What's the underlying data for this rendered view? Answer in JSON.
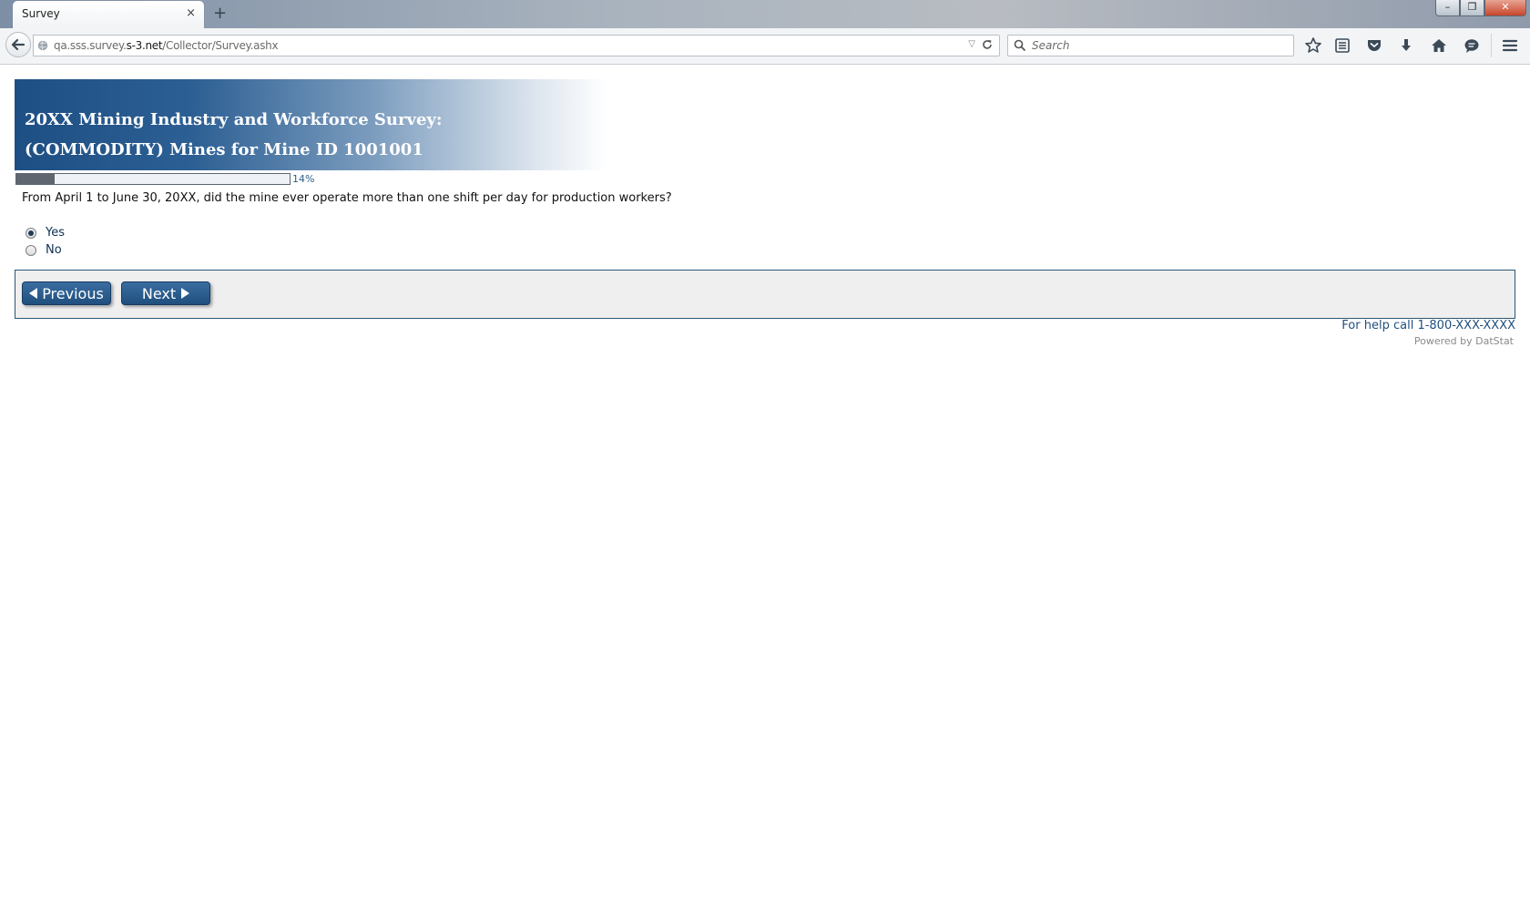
{
  "browser": {
    "tab_title": "Survey",
    "tab_close": "×",
    "new_tab": "+",
    "url_prefix": "qa.sss.survey.",
    "url_host": "s-3.net",
    "url_path": "/Collector/Survey.ashx",
    "search_placeholder": "Search",
    "window_min": "–",
    "window_max": "❐",
    "window_close": "✕"
  },
  "survey": {
    "title_line1": "20XX Mining Industry and Workforce Survey:",
    "title_line2": "(COMMODITY) Mines for Mine ID 1001001",
    "progress_percent": 14,
    "progress_label": "14%",
    "question": "From April 1 to June 30, 20XX, did the mine ever operate more than one shift per day for production workers?",
    "options": [
      {
        "label": "Yes",
        "selected": true
      },
      {
        "label": "No",
        "selected": false
      }
    ],
    "previous_label": "Previous",
    "next_label": "Next",
    "help_text": "For help call 1-800-XXX-XXXX",
    "powered_by": "Powered by DatStat"
  },
  "colors": {
    "brand_blue": "#1f4f7e",
    "banner_start": "#1e4f84",
    "progress_fill": "#5f6670"
  }
}
